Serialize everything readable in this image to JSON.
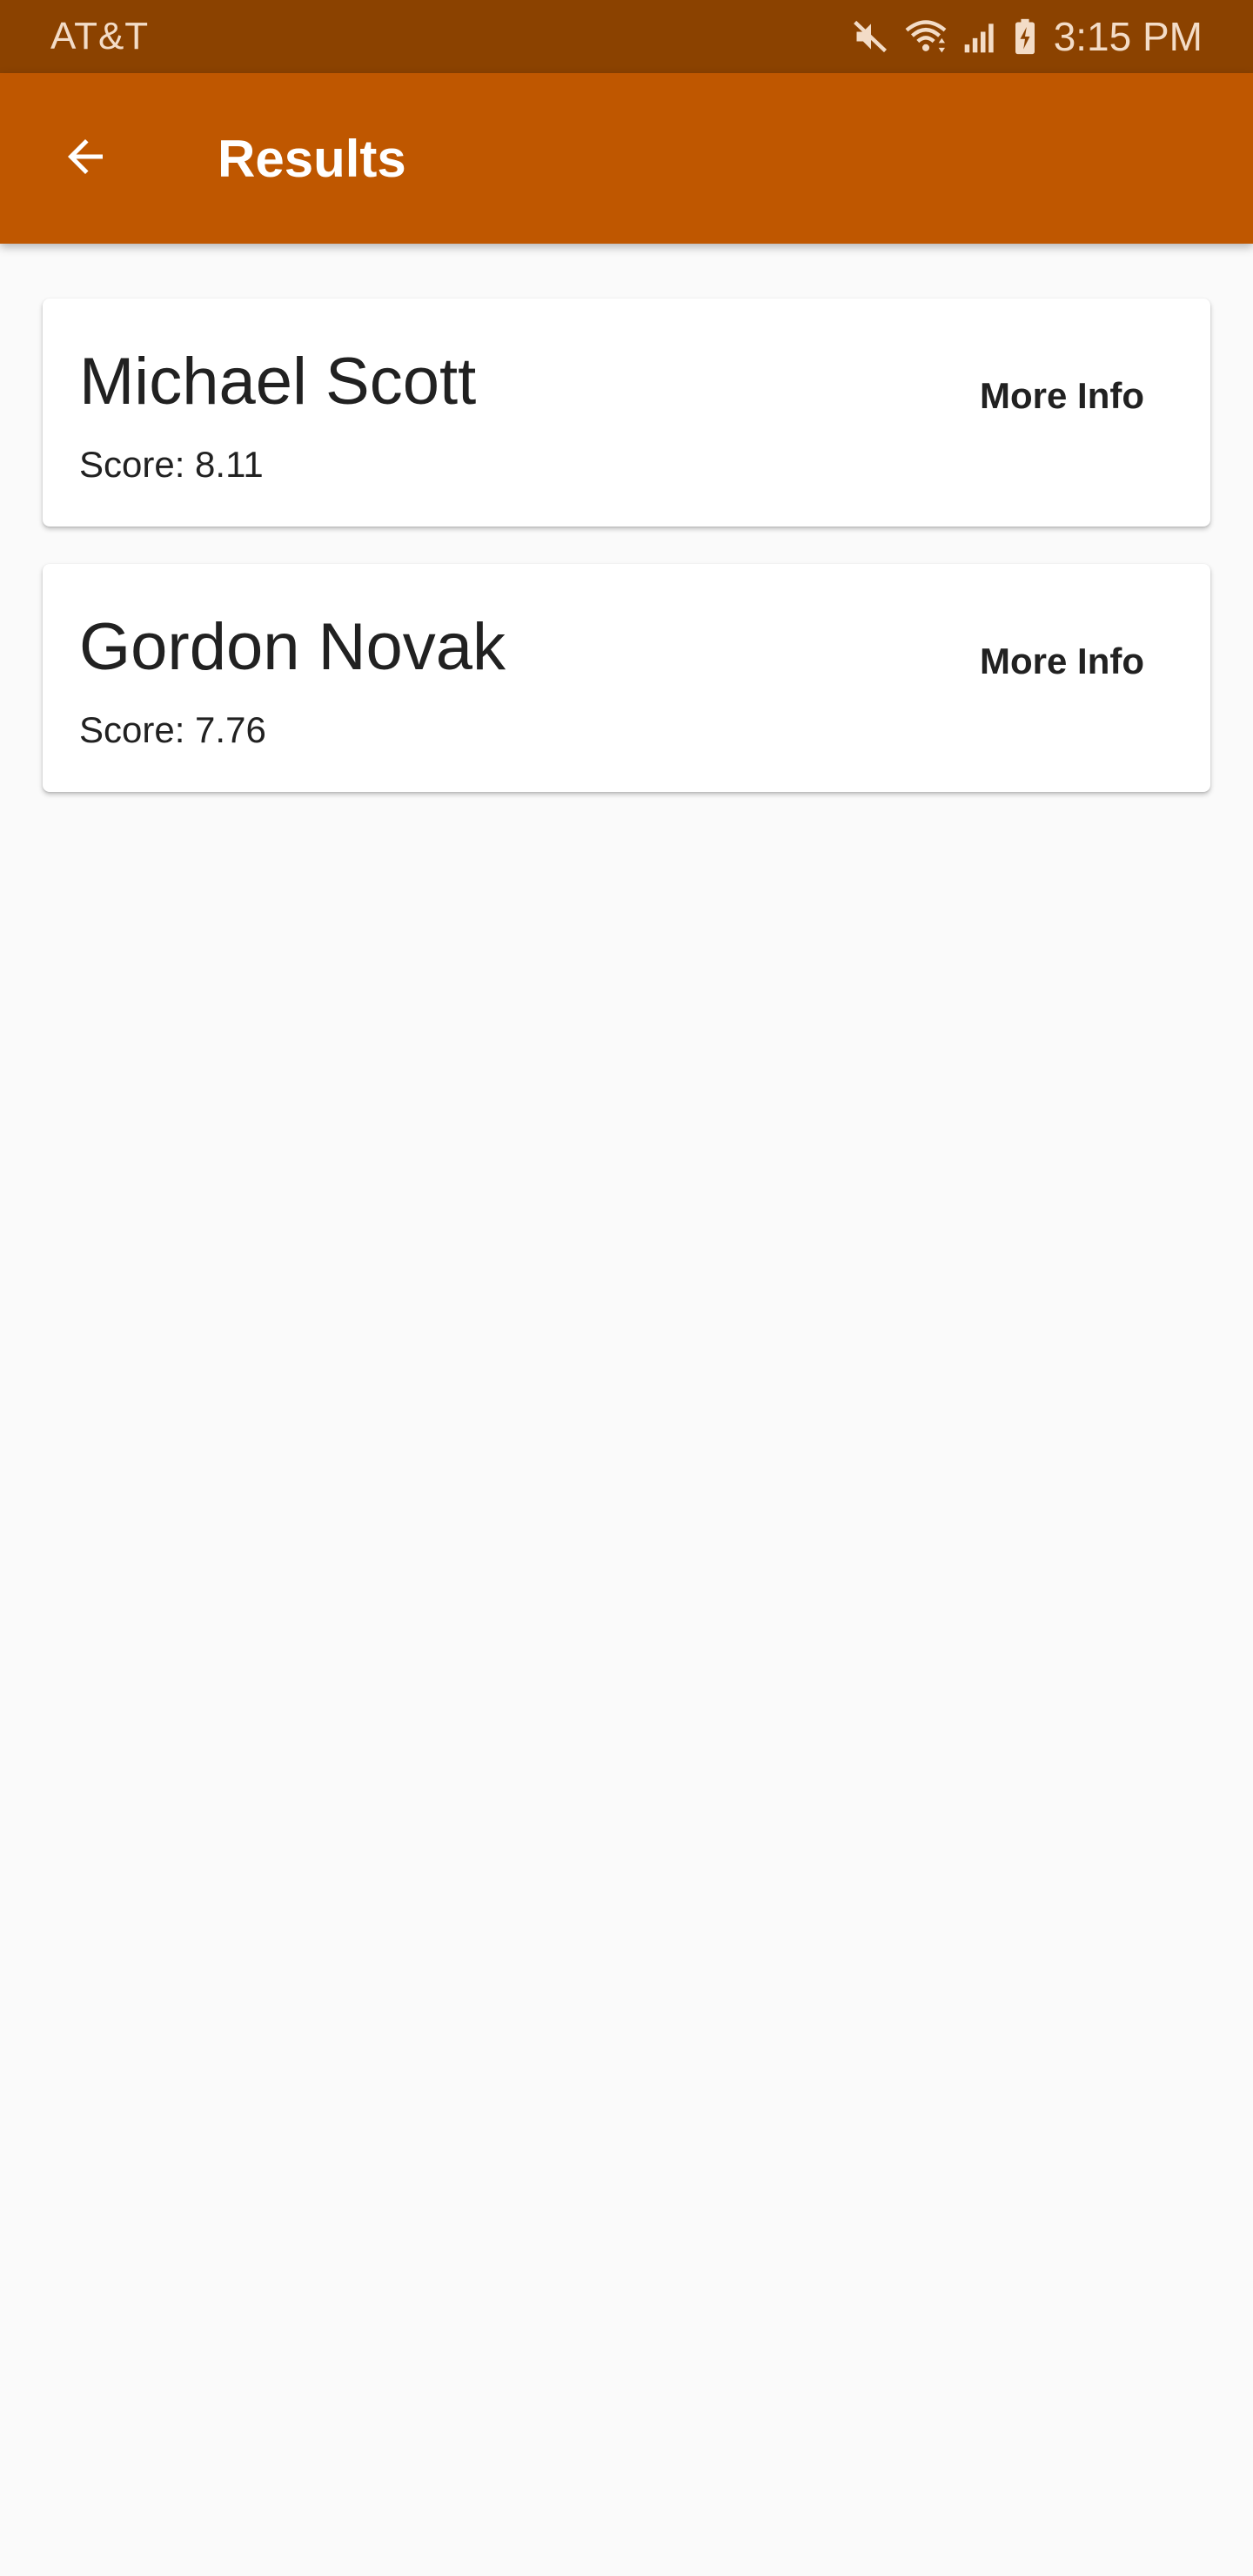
{
  "status_bar": {
    "carrier": "AT&T",
    "time": "3:15 PM",
    "icons": [
      "mute-icon",
      "wifi-icon",
      "signal-icon",
      "battery-charging-icon"
    ]
  },
  "app_bar": {
    "title": "Results",
    "back_icon": "arrow-back-icon",
    "background_color": "#bf5700"
  },
  "results": [
    {
      "name": "Michael Scott",
      "score": "Score: 8.11",
      "action_label": "More Info"
    },
    {
      "name": "Gordon Novak",
      "score": "Score: 7.76",
      "action_label": "More Info"
    }
  ],
  "colors": {
    "status_bar": "#8b4200",
    "app_bar": "#bf5700",
    "page_background": "#fafafa",
    "card_background": "#ffffff"
  }
}
